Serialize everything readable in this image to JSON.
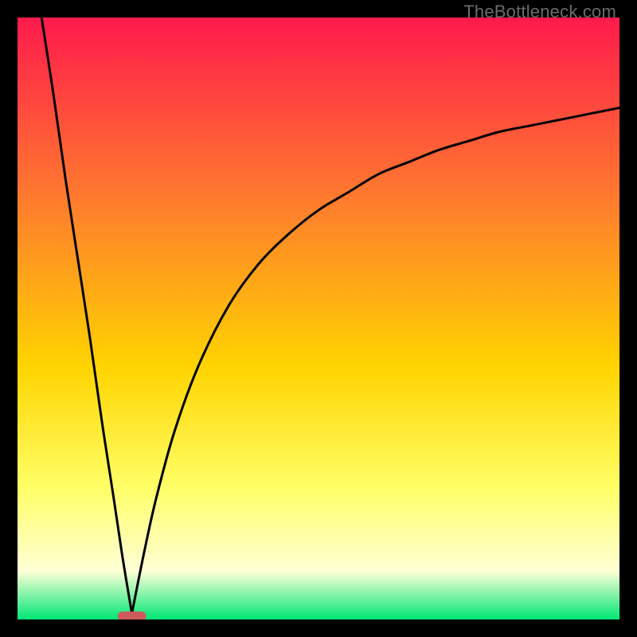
{
  "watermark": "TheBottleneck.com",
  "colors": {
    "gradient_top": "#ff1a4c",
    "gradient_mid1": "#ff7a2e",
    "gradient_mid2": "#ffd400",
    "gradient_mid3": "#ffff66",
    "gradient_mid4": "#ffffd6",
    "gradient_bottom": "#00e676",
    "frame": "#000000",
    "curve": "#000000",
    "marker": "#cc5b5b"
  },
  "chart_data": {
    "type": "line",
    "title": "",
    "xlabel": "",
    "ylabel": "",
    "xlim": [
      0,
      100
    ],
    "ylim": [
      0,
      100
    ],
    "grid": false,
    "annotations": [
      {
        "text": "TheBottleneck.com",
        "position": "top-right"
      }
    ],
    "marker": {
      "x": 19,
      "y": 0,
      "shape": "rounded-bar",
      "color": "#cc5b5b"
    },
    "series": [
      {
        "name": "left-branch",
        "comment": "Steep linear descent from top-left down to the notch near x≈19",
        "x": [
          4,
          6,
          8,
          10,
          12,
          14,
          16,
          17.5,
          19
        ],
        "y": [
          100,
          87,
          73,
          60,
          47,
          33,
          20,
          10,
          1
        ]
      },
      {
        "name": "right-branch",
        "comment": "Rises sharply from the notch then flattens asymptotically toward ~85",
        "x": [
          19,
          21,
          23,
          26,
          30,
          35,
          40,
          45,
          50,
          55,
          60,
          65,
          70,
          75,
          80,
          85,
          90,
          95,
          100
        ],
        "y": [
          1,
          11,
          20,
          31,
          42,
          52,
          59,
          64,
          68,
          71,
          74,
          76,
          78,
          79.5,
          81,
          82,
          83,
          84,
          85
        ]
      }
    ]
  }
}
